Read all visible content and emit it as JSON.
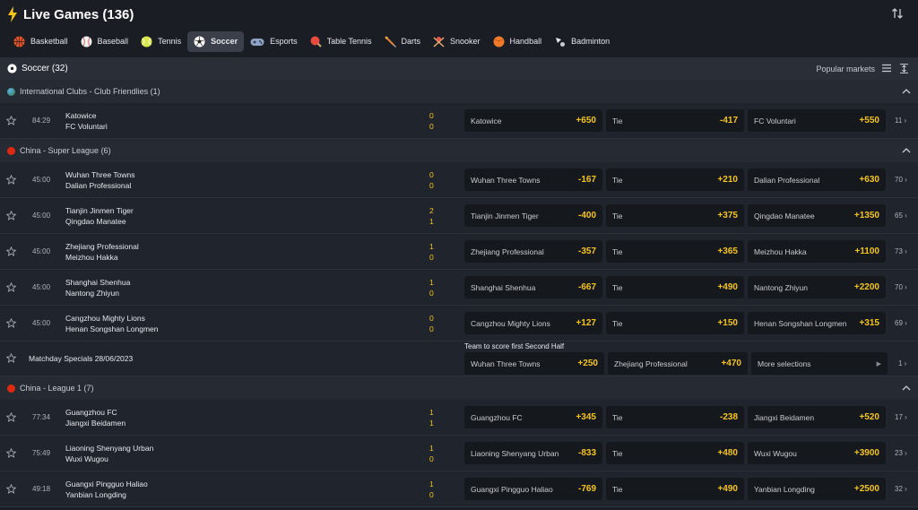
{
  "header": {
    "title": "Live Games (136)"
  },
  "sports": [
    {
      "label": "Basketball",
      "color": "#e8552b"
    },
    {
      "label": "Baseball",
      "color": "#f0f0f0"
    },
    {
      "label": "Tennis",
      "color": "#d7e84a"
    },
    {
      "label": "Soccer",
      "color": "#ffffff"
    },
    {
      "label": "Esports",
      "color": "#8fa3c7"
    },
    {
      "label": "Table Tennis",
      "color": "#e84b3c"
    },
    {
      "label": "Darts",
      "color": "#e8823c"
    },
    {
      "label": "Snooker",
      "color": "#e8554b"
    },
    {
      "label": "Handball",
      "color": "#f07a2a"
    },
    {
      "label": "Badminton",
      "color": "#c9ccd2"
    }
  ],
  "soccer": {
    "title": "Soccer (32)",
    "popular": "Popular markets"
  },
  "leagues": [
    {
      "name": "International Clubs - Club Friendlies (1)",
      "matches": [
        {
          "time": "84:29",
          "home": "Katowice",
          "away": "FC Voluntari",
          "s1": "0",
          "s2": "0",
          "o1l": "Katowice",
          "o1v": "+650",
          "o2l": "Tie",
          "o2v": "-417",
          "o3l": "FC Voluntari",
          "o3v": "+550",
          "more": "11 ›"
        }
      ]
    },
    {
      "name": "China - Super League (6)",
      "matches": [
        {
          "time": "45:00",
          "home": "Wuhan Three Towns",
          "away": "Dalian Professional",
          "s1": "0",
          "s2": "0",
          "o1l": "Wuhan Three Towns",
          "o1v": "-167",
          "o2l": "Tie",
          "o2v": "+210",
          "o3l": "Dalian Professional",
          "o3v": "+630",
          "more": "70 ›"
        },
        {
          "time": "45:00",
          "home": "Tianjin Jinmen Tiger",
          "away": "Qingdao Manatee",
          "s1": "2",
          "s2": "1",
          "o1l": "Tianjin Jinmen Tiger",
          "o1v": "-400",
          "o2l": "Tie",
          "o2v": "+375",
          "o3l": "Qingdao Manatee",
          "o3v": "+1350",
          "more": "65 ›"
        },
        {
          "time": "45:00",
          "home": "Zhejiang Professional",
          "away": "Meizhou Hakka",
          "s1": "1",
          "s2": "0",
          "o1l": "Zhejiang Professional",
          "o1v": "-357",
          "o2l": "Tie",
          "o2v": "+365",
          "o3l": "Meizhou Hakka",
          "o3v": "+1100",
          "more": "73 ›"
        },
        {
          "time": "45:00",
          "home": "Shanghai Shenhua",
          "away": "Nantong Zhiyun",
          "s1": "1",
          "s2": "0",
          "o1l": "Shanghai Shenhua",
          "o1v": "-667",
          "o2l": "Tie",
          "o2v": "+490",
          "o3l": "Nantong Zhiyun",
          "o3v": "+2200",
          "more": "70 ›"
        },
        {
          "time": "45:00",
          "home": "Cangzhou Mighty Lions",
          "away": "Henan Songshan Longmen",
          "s1": "0",
          "s2": "0",
          "o1l": "Cangzhou Mighty Lions",
          "o1v": "+127",
          "o2l": "Tie",
          "o2v": "+150",
          "o3l": "Henan Songshan Longmen",
          "o3v": "+315",
          "more": "69 ›"
        }
      ],
      "special": {
        "title": "Matchday Specials 28/06/2023",
        "subtitle": "Team to score first Second Half",
        "o1l": "Wuhan Three Towns",
        "o1v": "+250",
        "o2l": "Zhejiang Professional",
        "o2v": "+470",
        "o3l": "More selections",
        "o3v": "▶",
        "more": "1 ›"
      }
    },
    {
      "name": "China - League 1 (7)",
      "matches": [
        {
          "time": "77:34",
          "home": "Guangzhou FC",
          "away": "Jiangxi Beidamen",
          "s1": "1",
          "s2": "1",
          "o1l": "Guangzhou FC",
          "o1v": "+345",
          "o2l": "Tie",
          "o2v": "-238",
          "o3l": "Jiangxi Beidamen",
          "o3v": "+520",
          "more": "17 ›"
        },
        {
          "time": "75:49",
          "home": "Liaoning Shenyang Urban",
          "away": "Wuxi Wugou",
          "s1": "1",
          "s2": "0",
          "o1l": "Liaoning Shenyang Urban",
          "o1v": "-833",
          "o2l": "Tie",
          "o2v": "+480",
          "o3l": "Wuxi Wugou",
          "o3v": "+3900",
          "more": "23 ›"
        },
        {
          "time": "49:18",
          "home": "Guangxi Pingguo Haliao",
          "away": "Yanbian Longding",
          "s1": "1",
          "s2": "0",
          "o1l": "Guangxi Pingguo Haliao",
          "o1v": "-769",
          "o2l": "Tie",
          "o2v": "+490",
          "o3l": "Yanbian Longding",
          "o3v": "+2500",
          "more": "32 ›"
        }
      ]
    }
  ]
}
